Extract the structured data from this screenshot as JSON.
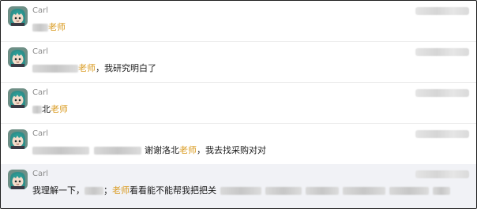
{
  "chat": {
    "messages": [
      {
        "sender": "Carl",
        "segments": [
          {
            "t": "blur",
            "w": 20
          },
          {
            "t": "hl",
            "v": "老师"
          }
        ]
      },
      {
        "sender": "Carl",
        "segments": [
          {
            "t": "blur",
            "w": 58
          },
          {
            "t": "hl",
            "v": "老师"
          },
          {
            "t": "text",
            "v": "，我研究明白了"
          }
        ]
      },
      {
        "sender": "Carl",
        "segments": [
          {
            "t": "blur",
            "w": 12
          },
          {
            "t": "text",
            "v": "北"
          },
          {
            "t": "hl",
            "v": "老师"
          }
        ]
      },
      {
        "sender": "Carl",
        "segments": [
          {
            "t": "blur",
            "w": 72
          },
          {
            "t": "space",
            "w": 6
          },
          {
            "t": "blur",
            "w": 60
          },
          {
            "t": "space",
            "w": 4
          },
          {
            "t": "text",
            "v": "谢谢洛北"
          },
          {
            "t": "hl",
            "v": "老师"
          },
          {
            "t": "text",
            "v": "，我去找采购对对"
          }
        ]
      },
      {
        "sender": "Carl",
        "segments": [
          {
            "t": "text",
            "v": "我理解一下，"
          },
          {
            "t": "blur",
            "w": 24
          },
          {
            "t": "text",
            "v": "；"
          },
          {
            "t": "hl",
            "v": "老师"
          },
          {
            "t": "text",
            "v": "看看能不能帮我把把关"
          },
          {
            "t": "space",
            "w": 5
          },
          {
            "t": "blur",
            "w": 52
          },
          {
            "t": "space",
            "w": 5
          },
          {
            "t": "blur",
            "w": 46
          },
          {
            "t": "space",
            "w": 5
          },
          {
            "t": "blur",
            "w": 42
          },
          {
            "t": "space",
            "w": 5
          },
          {
            "t": "blur",
            "w": 54
          },
          {
            "t": "space",
            "w": 5
          },
          {
            "t": "blur",
            "w": 50
          },
          {
            "t": "space",
            "w": 5
          },
          {
            "t": "blur",
            "w": 22
          }
        ]
      }
    ]
  },
  "colors": {
    "highlight_text": "#d99a1f",
    "selected_row_bg": "#f1f2f6",
    "sender_name": "#8b8b8b"
  },
  "icons": {
    "avatar": "green-hair-character-avatar"
  }
}
